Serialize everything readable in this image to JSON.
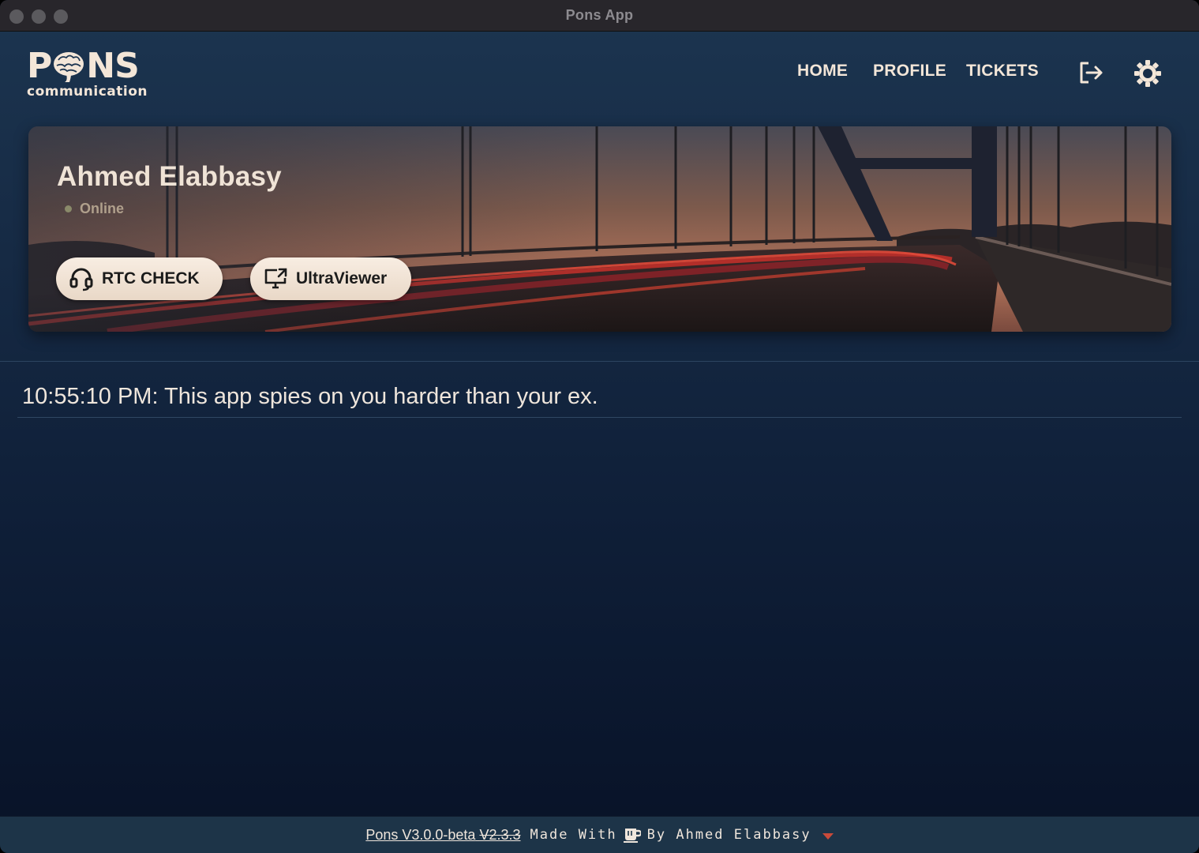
{
  "window": {
    "title": "Pons App"
  },
  "logo": {
    "top_text": "PONS",
    "letter_p": "P",
    "letters_ns": "NS",
    "subtitle": "communication"
  },
  "nav": {
    "home": "HOME",
    "profile": "PROFILE",
    "tickets": "TICKETS"
  },
  "icons": {
    "logout": "logout-icon",
    "settings": "sun-settings-icon",
    "rtc": "headset-icon",
    "ultraviewer": "screen-share-icon",
    "cup": "coffee-cup-icon"
  },
  "banner": {
    "user_name": "Ahmed Elabbasy",
    "status": "Online",
    "rtc_button": "RTC CHECK",
    "ultraviewer_button": "UltraViewer"
  },
  "message": {
    "text": "10:55:10 PM: This app spies on you harder than your ex."
  },
  "footer": {
    "version": "Pons V3.0.0-beta",
    "old_version": "V2.3.3",
    "made_with": "Made With",
    "by": "By Ahmed Elabbasy"
  },
  "colors": {
    "accent": "#c94a3a",
    "text": "#efe6dc",
    "pill": "#f3e6d8"
  }
}
